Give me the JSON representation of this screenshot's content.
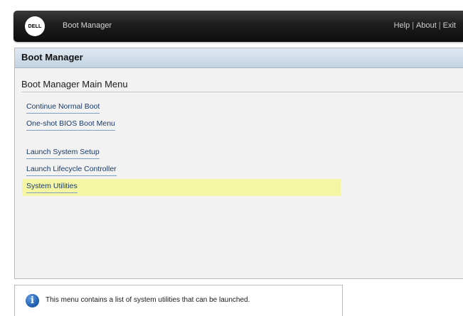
{
  "header": {
    "logo_text": "DELL",
    "title": "Boot Manager",
    "links": [
      "Help",
      "About",
      "Exit"
    ],
    "separator": "|"
  },
  "panel": {
    "title": "Boot Manager",
    "menu_title": "Boot Manager Main Menu",
    "items": [
      {
        "label": "Continue Normal Boot",
        "selected": false
      },
      {
        "label": "One-shot BIOS Boot Menu",
        "selected": false
      },
      {
        "label": "Launch System Setup",
        "selected": false
      },
      {
        "label": "Launch Lifecycle Controller",
        "selected": false
      },
      {
        "label": "System Utilities",
        "selected": true
      }
    ]
  },
  "help": {
    "icon": "info-icon",
    "icon_glyph": "i",
    "text": "This menu contains a list of system utilities that can be launched."
  },
  "colors": {
    "header_bar": "#1c1c1c",
    "panel_header": "#c9d8e6",
    "selected_item": "#f4f6a4",
    "link_text": "#1a3a66",
    "info_icon": "#1f5fb0"
  }
}
